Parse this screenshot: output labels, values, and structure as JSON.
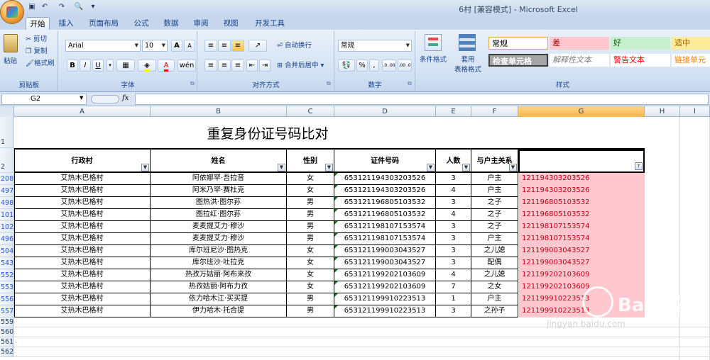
{
  "window": {
    "title": "6村 [兼容模式] - Microsoft Excel"
  },
  "tabs": [
    "开始",
    "插入",
    "页面布局",
    "公式",
    "数据",
    "审阅",
    "视图",
    "开发工具"
  ],
  "ribbon": {
    "clipboard": {
      "paste": "粘贴",
      "cut": "剪切",
      "copy": "复制",
      "format_painter": "格式刷",
      "label": "剪贴板"
    },
    "font": {
      "name": "Arial",
      "size": "10",
      "bold": "B",
      "italic": "I",
      "underline": "U",
      "grow": "A",
      "shrink": "A",
      "label": "字体",
      "phonetic": "wén"
    },
    "alignment": {
      "wrap": "自动换行",
      "merge": "合并后居中",
      "label": "对齐方式"
    },
    "number": {
      "format": "常规",
      "percent": "%",
      "comma": ",",
      "inc": ".0 .00",
      "dec": ".00 .0",
      "label": "数字"
    },
    "styles": {
      "conditional": "条件格式",
      "table": "套用\n表格格式",
      "label": "样式",
      "cells": [
        {
          "text": "常规",
          "bg": "#ffffff",
          "color": "#000000"
        },
        {
          "text": "差",
          "bg": "#ffc7ce",
          "color": "#9c0006"
        },
        {
          "text": "好",
          "bg": "#c6efce",
          "color": "#006100"
        },
        {
          "text": "适中",
          "bg": "#ffeb9c",
          "color": "#9c6500"
        },
        {
          "text": "检查单元格",
          "bg": "#a5a5a5",
          "color": "#ffffff"
        },
        {
          "text": "解释性文本",
          "bg": "#ffffff",
          "color": "#7f7f7f"
        },
        {
          "text": "警告文本",
          "bg": "#ffffff",
          "color": "#ff0000"
        },
        {
          "text": "链接单元",
          "bg": "#ffffff",
          "color": "#fa7d00"
        }
      ]
    }
  },
  "formula_bar": {
    "name_box": "G2",
    "fx": "fx",
    "content": ""
  },
  "columns": [
    "A",
    "B",
    "C",
    "D",
    "E",
    "F",
    "G",
    "H",
    "I"
  ],
  "sheet": {
    "title": "重复身份证号码比对",
    "headers": [
      "行政村",
      "姓名",
      "性别",
      "证件号码",
      "人数",
      "与户主关系",
      ""
    ],
    "rows": [
      {
        "rn": "208",
        "village": "艾热木巴格村",
        "name": "阿依娜罕·吾拉音",
        "sex": "女",
        "id": "653121194303203526",
        "count": "3",
        "rel": "户主",
        "g": "121194303203526"
      },
      {
        "rn": "497",
        "village": "艾热木巴格村",
        "name": "阿米乃罕·赛杜克",
        "sex": "女",
        "id": "653121194303203526",
        "count": "4",
        "rel": "户主",
        "g": "121194303203526"
      },
      {
        "rn": "498",
        "village": "艾热木巴格村",
        "name": "图热洪·图尔荪",
        "sex": "男",
        "id": "653121196805103532",
        "count": "3",
        "rel": "之子",
        "g": "121196805103532"
      },
      {
        "rn": "101",
        "village": "艾热木巴格村",
        "name": "图拉红·图尔荪",
        "sex": "男",
        "id": "653121196805103532",
        "count": "4",
        "rel": "之子",
        "g": "121196805103532"
      },
      {
        "rn": "102",
        "village": "艾热木巴格村",
        "name": "麦麦提艾力·穆沙",
        "sex": "男",
        "id": "653121198107153574",
        "count": "3",
        "rel": "之子",
        "g": "121198107153574"
      },
      {
        "rn": "496",
        "village": "艾热木巴格村",
        "name": "麦麦提艾力·穆沙",
        "sex": "男",
        "id": "653121198107153574",
        "count": "3",
        "rel": "户主",
        "g": "121198107153574"
      },
      {
        "rn": "504",
        "village": "艾热木巴格村",
        "name": "库尔班尼沙·图热克",
        "sex": "女",
        "id": "653121199003043527",
        "count": "3",
        "rel": "之儿媳",
        "g": "121199003043527"
      },
      {
        "rn": "543",
        "village": "艾热木巴格村",
        "name": "库尔班沙·吐拉克",
        "sex": "女",
        "id": "653121199003043527",
        "count": "3",
        "rel": "配偶",
        "g": "121199003043527"
      },
      {
        "rn": "552",
        "village": "艾热木巴格村",
        "name": "热孜万姑丽·阿布来孜",
        "sex": "女",
        "id": "653121199202103609",
        "count": "4",
        "rel": "之儿媳",
        "g": "121199202103609"
      },
      {
        "rn": "553",
        "village": "艾热木巴格村",
        "name": "热孜姑丽·阿布力孜",
        "sex": "女",
        "id": "653121199202103609",
        "count": "7",
        "rel": "之女",
        "g": "121199202103609"
      },
      {
        "rn": "556",
        "village": "艾热木巴格村",
        "name": "依力哈木江·买买提",
        "sex": "男",
        "id": "653121199910223513",
        "count": "1",
        "rel": "户主",
        "g": "121199910223513"
      },
      {
        "rn": "557",
        "village": "艾热木巴格村",
        "name": "伊力哈木·托合提",
        "sex": "男",
        "id": "653121199910223513",
        "count": "3",
        "rel": "之孙子",
        "g": "121199910223513"
      }
    ],
    "empty_rows": [
      "559",
      "560",
      "561",
      "562"
    ],
    "row1": "1",
    "row2": "2"
  },
  "watermark": {
    "text": "Bai 经验",
    "url": "jingyan.baidu.com"
  }
}
